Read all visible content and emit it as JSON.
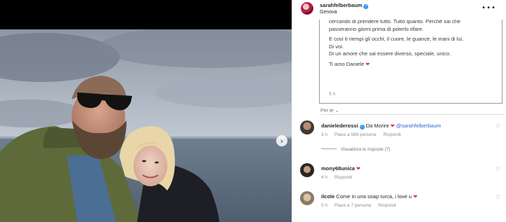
{
  "post": {
    "username": "sarahfelberbaum",
    "location": "Genova",
    "caption_lines": [
      [
        "cercando di prendere tutto. Tutto quanto. Perché sai che",
        "passeranno giorni prima di poterlo rifare."
      ],
      [
        "E così ti riempi gli occhi, il cuore, le guance, le mani di lui.",
        "Di voi.",
        "Di un amore che sai essere diverso, speciale, unico."
      ],
      [
        "Ti amo Daniele"
      ]
    ],
    "caption_time": "5 h",
    "see_translation": "Per te"
  },
  "comments": [
    {
      "username": "danielederossi",
      "verified": true,
      "text": "Da Morire",
      "mention": "@sarahfelberbaum",
      "time": "3 h",
      "likes": "Piace a 588 persone",
      "reply": "Rispondi",
      "view_replies": "Visualizza le risposte (7)"
    },
    {
      "username": "mony68unica",
      "text": "",
      "time": "4 h",
      "reply": "Rispondi"
    },
    {
      "username": "ilcole",
      "text": "Come in una soap turca, i love u",
      "time": "5 h",
      "likes": "Piace a 7 persone",
      "reply": "Rispondi"
    }
  ],
  "icons": {
    "next": "chevron-right-icon",
    "more": "more-options-icon",
    "heart": "heart-icon",
    "verified": "verified-badge-icon",
    "like": "like-heart-icon"
  },
  "colors": {
    "heart": "#e2305f",
    "verified": "#3897f0",
    "mention": "#3366cc"
  }
}
